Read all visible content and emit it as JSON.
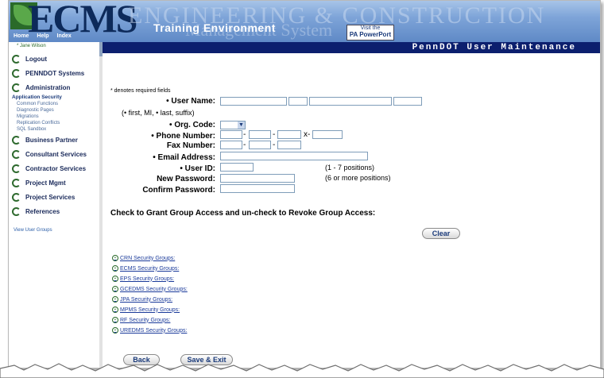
{
  "header": {
    "logo_text": "ECMS",
    "background_text": "ENGINEERING & CONSTRUCTION",
    "background_text_2": "Management System",
    "environment": "Training Environment",
    "badge_top": "Visit the",
    "badge_brand": "PA PowerPort",
    "topnav": [
      "Home",
      "Help",
      "Index"
    ]
  },
  "titlebar": {
    "title": "PennDOT User Maintenance"
  },
  "sidebar": {
    "user": "* Jane Wilson",
    "items": [
      {
        "label": "Logout"
      },
      {
        "label": "PENNDOT Systems"
      },
      {
        "label": "Administration"
      }
    ],
    "security_heading": "Application Security",
    "security_links": [
      "Common Functions",
      "Diagnostic Pages",
      "Migrations",
      "Replication Conflicts",
      "SQL Sandbox"
    ],
    "items2": [
      {
        "label": "Business Partner"
      },
      {
        "label": "Consultant Services"
      },
      {
        "label": "Contractor Services"
      },
      {
        "label": "Project Mgmt"
      },
      {
        "label": "Project Services"
      },
      {
        "label": "References"
      }
    ],
    "view_groups": "View User Groups"
  },
  "form": {
    "required_note": "* denotes required fields",
    "user_name_label": "• User Name:",
    "name_hint": "(• first, MI, • last, suffix)",
    "org_code_label": "• Org. Code:",
    "phone_label": "• Phone Number:",
    "fax_label": "Fax Number:",
    "email_label": "• Email Address:",
    "user_id_label": "• User ID:",
    "user_id_hint": "(1 - 7 positions)",
    "new_password_label": "New Password:",
    "new_password_hint": "(6 or more positions)",
    "confirm_password_label": "Confirm Password:",
    "dash": "-",
    "ext": "x-"
  },
  "grant": {
    "text": "Check to Grant Group Access and un-check to Revoke Group Access:"
  },
  "buttons": {
    "clear": "Clear",
    "back": "Back",
    "save_exit": "Save & Exit"
  },
  "groups": [
    "CRN Security Groups:",
    "ECMS Security Groups:",
    "EPS Security Groups:",
    "GCEDMS Security Groups:",
    "JPA Security Groups:",
    "MPMS Security Groups:",
    "RF Security Groups:",
    "UREDMS Security Groups:"
  ],
  "colors": {
    "title_bar": "#0c1f6e",
    "nav_green": "#2e6a2e",
    "link_blue": "#1a3a9a"
  }
}
